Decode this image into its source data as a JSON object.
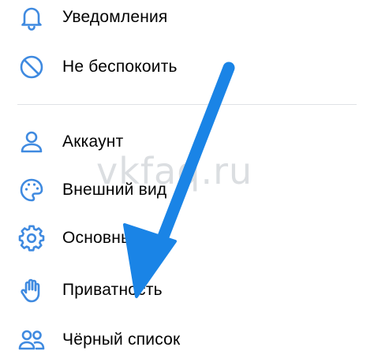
{
  "menu": {
    "items": [
      {
        "label": "Уведомления",
        "icon": "bell-icon"
      },
      {
        "label": "Не беспокоить",
        "icon": "do-not-disturb-icon"
      },
      {
        "label": "Аккаунт",
        "icon": "user-icon"
      },
      {
        "label": "Внешний вид",
        "icon": "palette-icon"
      },
      {
        "label": "Основные",
        "icon": "gear-icon"
      },
      {
        "label": "Приватность",
        "icon": "hand-icon"
      },
      {
        "label": "Чёрный список",
        "icon": "users-icon"
      }
    ]
  },
  "watermark": "vkfaq.ru",
  "colors": {
    "icon": "#3f8ae0",
    "arrow": "#1a84e6",
    "text": "#000000",
    "divider": "#dfe2e6"
  }
}
